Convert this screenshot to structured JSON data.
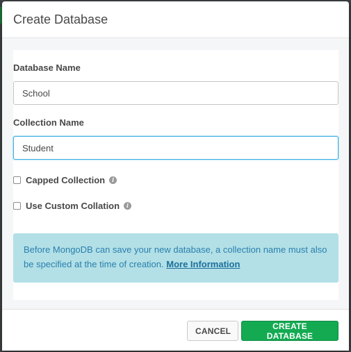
{
  "dialog": {
    "title": "Create Database"
  },
  "form": {
    "database_name_label": "Database Name",
    "database_name_value": "School",
    "collection_name_label": "Collection Name",
    "collection_name_value": "Student",
    "capped_collection_label": "Capped Collection",
    "capped_collection_checked": false,
    "custom_collation_label": "Use Custom Collation",
    "custom_collation_checked": false
  },
  "info_banner": {
    "text": "Before MongoDB can save your new database, a collection name must also be specified at the time of creation. ",
    "link_text": "More Information"
  },
  "footer": {
    "cancel_label": "CANCEL",
    "create_label": "CREATE DATABASE"
  },
  "colors": {
    "primary_button": "#13aa52",
    "info_background": "#b2e0e6",
    "info_text": "#2b7fae",
    "focus_border": "#43b1e5"
  },
  "icons": {
    "info": "info-circle-icon"
  }
}
